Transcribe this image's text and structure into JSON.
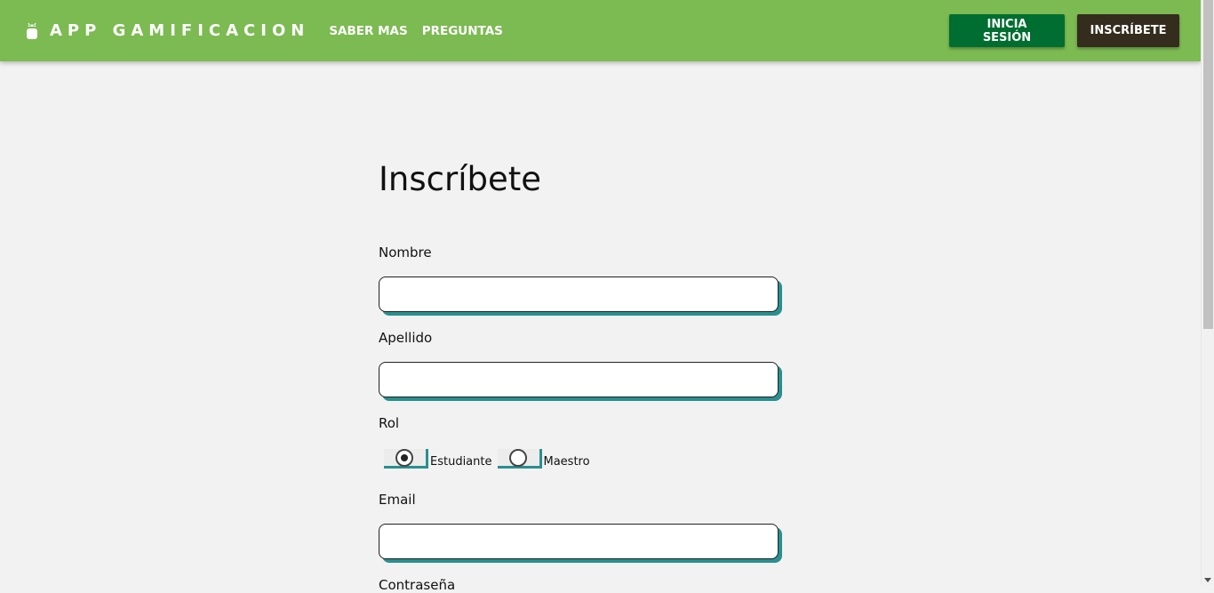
{
  "navbar": {
    "brand_icon": "android-icon",
    "brand": "APP GAMIFICACION",
    "links": [
      "SABER MAS",
      "PREGUNTAS"
    ],
    "login_label": "INICIA SESIÓN",
    "signup_label": "INSCRÍBETE",
    "colors": {
      "bar": "#7cba52",
      "login": "#006e30",
      "signup": "#342c1d"
    }
  },
  "form": {
    "title": "Inscríbete",
    "fields": {
      "nombre": {
        "label": "Nombre",
        "value": ""
      },
      "apellido": {
        "label": "Apellido",
        "value": ""
      },
      "rol": {
        "label": "Rol",
        "options": [
          {
            "label": "Estudiante",
            "checked": true
          },
          {
            "label": "Maestro",
            "checked": false
          }
        ]
      },
      "email": {
        "label": "Email",
        "value": ""
      },
      "contrasena": {
        "label": "Contraseña"
      }
    },
    "accent_shadow": "#2a8f8f"
  }
}
